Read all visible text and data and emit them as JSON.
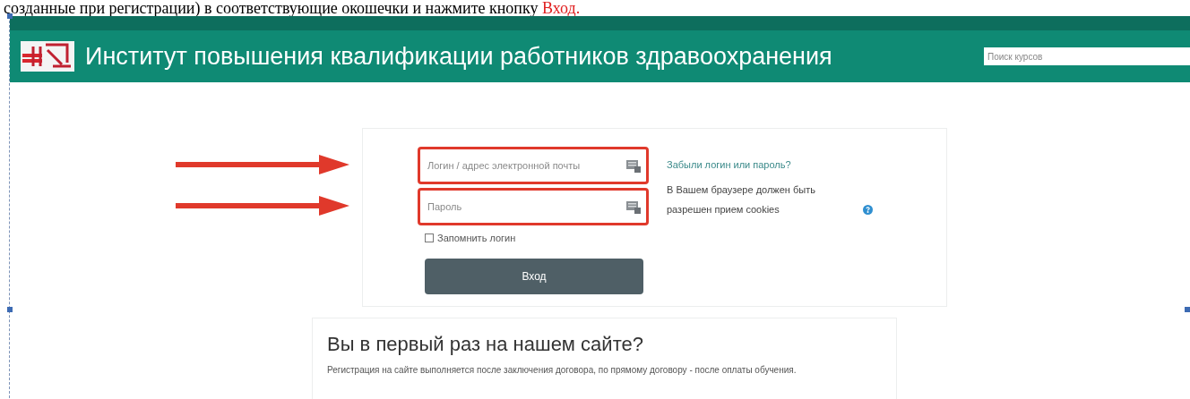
{
  "document_text": {
    "text": "созданные при регистрации) в соответствующие окошечки и нажмите кнопку ",
    "highlight": "Вход."
  },
  "header": {
    "title": "Институт повышения квалификации работников здравоохранения",
    "search": {
      "placeholder": "Поиск курсов"
    }
  },
  "login": {
    "fields": [
      {
        "placeholder": "Логин / адрес электронной почты",
        "highlighted": true
      },
      {
        "placeholder": "Пароль",
        "highlighted": true
      }
    ],
    "remember": {
      "label": "Запомнить логин",
      "checked": false
    },
    "button": "Вход",
    "forgot_link": "Забыли логин или пароль?",
    "cookies_note": "В Вашем браузере должен быть разрешен прием cookies"
  },
  "signup": {
    "heading": "Вы в первый раз на нашем сайте?",
    "text": "Регистрация на сайте выполняется после заключения договора, по прямому договору - после оплаты обучения."
  }
}
